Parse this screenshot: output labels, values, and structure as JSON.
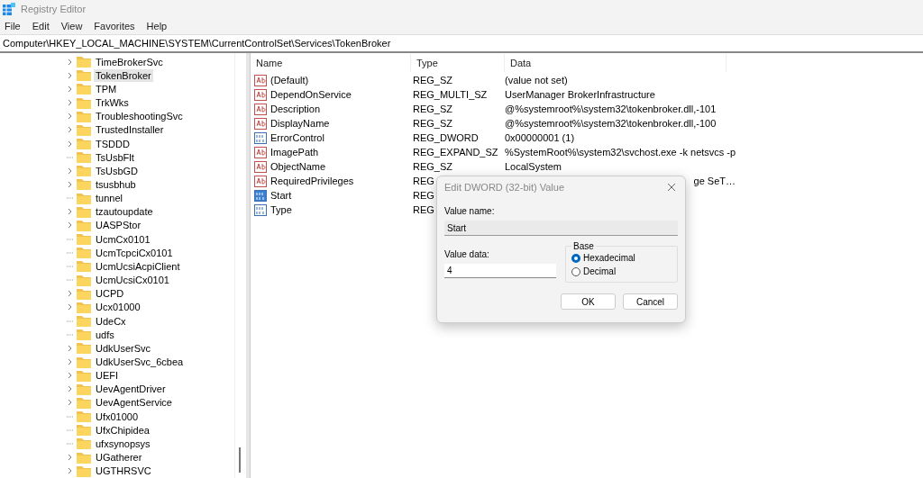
{
  "window": {
    "title": "Registry Editor"
  },
  "menu": [
    "File",
    "Edit",
    "View",
    "Favorites",
    "Help"
  ],
  "address": "Computer\\HKEY_LOCAL_MACHINE\\SYSTEM\\CurrentControlSet\\Services\\TokenBroker",
  "tree": [
    {
      "label": "TimeBrokerSvc",
      "kind": "expandable",
      "selected": false
    },
    {
      "label": "TokenBroker",
      "kind": "expandable",
      "selected": true
    },
    {
      "label": "TPM",
      "kind": "expandable",
      "selected": false
    },
    {
      "label": "TrkWks",
      "kind": "expandable",
      "selected": false
    },
    {
      "label": "TroubleshootingSvc",
      "kind": "expandable",
      "selected": false
    },
    {
      "label": "TrustedInstaller",
      "kind": "expandable",
      "selected": false
    },
    {
      "label": "TSDDD",
      "kind": "expandable",
      "selected": false
    },
    {
      "label": "TsUsbFlt",
      "kind": "leaf",
      "selected": false
    },
    {
      "label": "TsUsbGD",
      "kind": "expandable",
      "selected": false
    },
    {
      "label": "tsusbhub",
      "kind": "expandable",
      "selected": false
    },
    {
      "label": "tunnel",
      "kind": "leaf",
      "selected": false
    },
    {
      "label": "tzautoupdate",
      "kind": "expandable",
      "selected": false
    },
    {
      "label": "UASPStor",
      "kind": "expandable",
      "selected": false
    },
    {
      "label": "UcmCx0101",
      "kind": "leaf",
      "selected": false
    },
    {
      "label": "UcmTcpciCx0101",
      "kind": "leaf",
      "selected": false
    },
    {
      "label": "UcmUcsiAcpiClient",
      "kind": "leaf",
      "selected": false
    },
    {
      "label": "UcmUcsiCx0101",
      "kind": "leaf",
      "selected": false
    },
    {
      "label": "UCPD",
      "kind": "expandable",
      "selected": false
    },
    {
      "label": "Ucx01000",
      "kind": "expandable",
      "selected": false
    },
    {
      "label": "UdeCx",
      "kind": "leaf",
      "selected": false
    },
    {
      "label": "udfs",
      "kind": "leaf",
      "selected": false
    },
    {
      "label": "UdkUserSvc",
      "kind": "expandable",
      "selected": false
    },
    {
      "label": "UdkUserSvc_6cbea",
      "kind": "expandable",
      "selected": false
    },
    {
      "label": "UEFI",
      "kind": "expandable",
      "selected": false
    },
    {
      "label": "UevAgentDriver",
      "kind": "expandable",
      "selected": false
    },
    {
      "label": "UevAgentService",
      "kind": "expandable",
      "selected": false
    },
    {
      "label": "Ufx01000",
      "kind": "leaf",
      "selected": false
    },
    {
      "label": "UfxChipidea",
      "kind": "leaf",
      "selected": false
    },
    {
      "label": "ufxsynopsys",
      "kind": "leaf",
      "selected": false
    },
    {
      "label": "UGatherer",
      "kind": "expandable",
      "selected": false
    },
    {
      "label": "UGTHRSVC",
      "kind": "expandable",
      "selected": false
    }
  ],
  "columns": [
    "Name",
    "Type",
    "Data"
  ],
  "values": [
    {
      "name": "(Default)",
      "kind": "string",
      "type": "REG_SZ",
      "data": "(value not set)",
      "selected": false
    },
    {
      "name": "DependOnService",
      "kind": "string",
      "type": "REG_MULTI_SZ",
      "data": "UserManager BrokerInfrastructure",
      "selected": false
    },
    {
      "name": "Description",
      "kind": "string",
      "type": "REG_SZ",
      "data": "@%systemroot%\\system32\\tokenbroker.dll,-101",
      "selected": false
    },
    {
      "name": "DisplayName",
      "kind": "string",
      "type": "REG_SZ",
      "data": "@%systemroot%\\system32\\tokenbroker.dll,-100",
      "selected": false
    },
    {
      "name": "ErrorControl",
      "kind": "binary",
      "type": "REG_DWORD",
      "data": "0x00000001 (1)",
      "selected": false
    },
    {
      "name": "ImagePath",
      "kind": "string",
      "type": "REG_EXPAND_SZ",
      "data": "%SystemRoot%\\system32\\svchost.exe -k netsvcs -p",
      "selected": false
    },
    {
      "name": "ObjectName",
      "kind": "string",
      "type": "REG_SZ",
      "data": "LocalSystem",
      "selected": false
    },
    {
      "name": "RequiredPrivileges",
      "kind": "string",
      "type": "REG",
      "data_tail": "ge SeT…",
      "selected": false
    },
    {
      "name": "Start",
      "kind": "binary",
      "type": "REG",
      "selected": true
    },
    {
      "name": "Type",
      "kind": "binary",
      "type": "REG",
      "selected": false
    }
  ],
  "dialog": {
    "title": "Edit DWORD (32-bit) Value",
    "name_label": "Value name:",
    "name_value": "Start",
    "data_label": "Value data:",
    "data_value": "4",
    "base_label": "Base",
    "bases": [
      {
        "label": "Hexadecimal",
        "selected": true
      },
      {
        "label": "Decimal",
        "selected": false
      }
    ],
    "buttons": [
      "OK",
      "Cancel"
    ]
  }
}
